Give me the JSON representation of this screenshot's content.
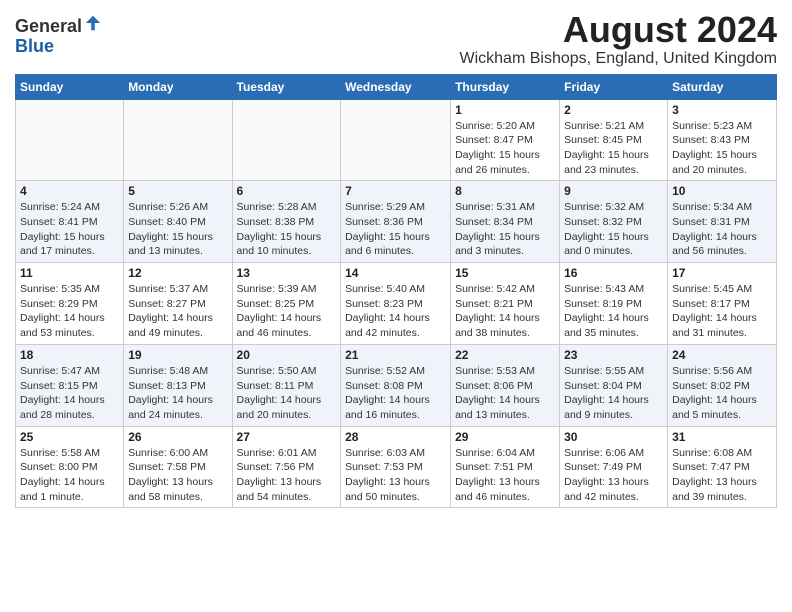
{
  "logo": {
    "general": "General",
    "blue": "Blue"
  },
  "title": "August 2024",
  "location": "Wickham Bishops, England, United Kingdom",
  "weekdays": [
    "Sunday",
    "Monday",
    "Tuesday",
    "Wednesday",
    "Thursday",
    "Friday",
    "Saturday"
  ],
  "weeks": [
    [
      {
        "day": "",
        "info": ""
      },
      {
        "day": "",
        "info": ""
      },
      {
        "day": "",
        "info": ""
      },
      {
        "day": "",
        "info": ""
      },
      {
        "day": "1",
        "info": "Sunrise: 5:20 AM\nSunset: 8:47 PM\nDaylight: 15 hours\nand 26 minutes."
      },
      {
        "day": "2",
        "info": "Sunrise: 5:21 AM\nSunset: 8:45 PM\nDaylight: 15 hours\nand 23 minutes."
      },
      {
        "day": "3",
        "info": "Sunrise: 5:23 AM\nSunset: 8:43 PM\nDaylight: 15 hours\nand 20 minutes."
      }
    ],
    [
      {
        "day": "4",
        "info": "Sunrise: 5:24 AM\nSunset: 8:41 PM\nDaylight: 15 hours\nand 17 minutes."
      },
      {
        "day": "5",
        "info": "Sunrise: 5:26 AM\nSunset: 8:40 PM\nDaylight: 15 hours\nand 13 minutes."
      },
      {
        "day": "6",
        "info": "Sunrise: 5:28 AM\nSunset: 8:38 PM\nDaylight: 15 hours\nand 10 minutes."
      },
      {
        "day": "7",
        "info": "Sunrise: 5:29 AM\nSunset: 8:36 PM\nDaylight: 15 hours\nand 6 minutes."
      },
      {
        "day": "8",
        "info": "Sunrise: 5:31 AM\nSunset: 8:34 PM\nDaylight: 15 hours\nand 3 minutes."
      },
      {
        "day": "9",
        "info": "Sunrise: 5:32 AM\nSunset: 8:32 PM\nDaylight: 15 hours\nand 0 minutes."
      },
      {
        "day": "10",
        "info": "Sunrise: 5:34 AM\nSunset: 8:31 PM\nDaylight: 14 hours\nand 56 minutes."
      }
    ],
    [
      {
        "day": "11",
        "info": "Sunrise: 5:35 AM\nSunset: 8:29 PM\nDaylight: 14 hours\nand 53 minutes."
      },
      {
        "day": "12",
        "info": "Sunrise: 5:37 AM\nSunset: 8:27 PM\nDaylight: 14 hours\nand 49 minutes."
      },
      {
        "day": "13",
        "info": "Sunrise: 5:39 AM\nSunset: 8:25 PM\nDaylight: 14 hours\nand 46 minutes."
      },
      {
        "day": "14",
        "info": "Sunrise: 5:40 AM\nSunset: 8:23 PM\nDaylight: 14 hours\nand 42 minutes."
      },
      {
        "day": "15",
        "info": "Sunrise: 5:42 AM\nSunset: 8:21 PM\nDaylight: 14 hours\nand 38 minutes."
      },
      {
        "day": "16",
        "info": "Sunrise: 5:43 AM\nSunset: 8:19 PM\nDaylight: 14 hours\nand 35 minutes."
      },
      {
        "day": "17",
        "info": "Sunrise: 5:45 AM\nSunset: 8:17 PM\nDaylight: 14 hours\nand 31 minutes."
      }
    ],
    [
      {
        "day": "18",
        "info": "Sunrise: 5:47 AM\nSunset: 8:15 PM\nDaylight: 14 hours\nand 28 minutes."
      },
      {
        "day": "19",
        "info": "Sunrise: 5:48 AM\nSunset: 8:13 PM\nDaylight: 14 hours\nand 24 minutes."
      },
      {
        "day": "20",
        "info": "Sunrise: 5:50 AM\nSunset: 8:11 PM\nDaylight: 14 hours\nand 20 minutes."
      },
      {
        "day": "21",
        "info": "Sunrise: 5:52 AM\nSunset: 8:08 PM\nDaylight: 14 hours\nand 16 minutes."
      },
      {
        "day": "22",
        "info": "Sunrise: 5:53 AM\nSunset: 8:06 PM\nDaylight: 14 hours\nand 13 minutes."
      },
      {
        "day": "23",
        "info": "Sunrise: 5:55 AM\nSunset: 8:04 PM\nDaylight: 14 hours\nand 9 minutes."
      },
      {
        "day": "24",
        "info": "Sunrise: 5:56 AM\nSunset: 8:02 PM\nDaylight: 14 hours\nand 5 minutes."
      }
    ],
    [
      {
        "day": "25",
        "info": "Sunrise: 5:58 AM\nSunset: 8:00 PM\nDaylight: 14 hours\nand 1 minute."
      },
      {
        "day": "26",
        "info": "Sunrise: 6:00 AM\nSunset: 7:58 PM\nDaylight: 13 hours\nand 58 minutes."
      },
      {
        "day": "27",
        "info": "Sunrise: 6:01 AM\nSunset: 7:56 PM\nDaylight: 13 hours\nand 54 minutes."
      },
      {
        "day": "28",
        "info": "Sunrise: 6:03 AM\nSunset: 7:53 PM\nDaylight: 13 hours\nand 50 minutes."
      },
      {
        "day": "29",
        "info": "Sunrise: 6:04 AM\nSunset: 7:51 PM\nDaylight: 13 hours\nand 46 minutes."
      },
      {
        "day": "30",
        "info": "Sunrise: 6:06 AM\nSunset: 7:49 PM\nDaylight: 13 hours\nand 42 minutes."
      },
      {
        "day": "31",
        "info": "Sunrise: 6:08 AM\nSunset: 7:47 PM\nDaylight: 13 hours\nand 39 minutes."
      }
    ]
  ]
}
